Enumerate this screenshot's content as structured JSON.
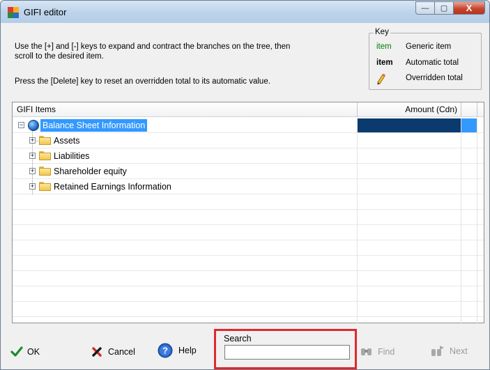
{
  "window": {
    "title": "GIFI editor",
    "minimize_glyph": "—",
    "maximize_glyph": "▢",
    "close_glyph": "X"
  },
  "instructions": {
    "line1": "Use the [+] and [-] keys to expand and contract the branches on the tree, then",
    "line2": "scroll to the desired item.",
    "line3": "Press the [Delete] key to reset an overridden total to its automatic value."
  },
  "key": {
    "legend": "Key",
    "generic_sample": "item",
    "generic_label": "Generic item",
    "automatic_sample": "item",
    "automatic_label": "Automatic total",
    "overridden_label": "Overridden total"
  },
  "grid": {
    "col_items": "GIFI Items",
    "col_amount": "Amount (Cdn)",
    "root": "Balance Sheet Information",
    "children": [
      "Assets",
      "Liabilities",
      "Shareholder equity",
      "Retained Earnings Information"
    ],
    "expand_glyph": "+",
    "collapse_glyph": "−"
  },
  "buttons": {
    "ok": "OK",
    "cancel": "Cancel",
    "help": "Help",
    "find": "Find",
    "next": "Next"
  },
  "search": {
    "label": "Search",
    "value": ""
  },
  "colors": {
    "selection": "#3399ff",
    "amount_selected": "#0b3a6e",
    "generic_item": "#008000",
    "search_highlight": "#e0282e"
  }
}
